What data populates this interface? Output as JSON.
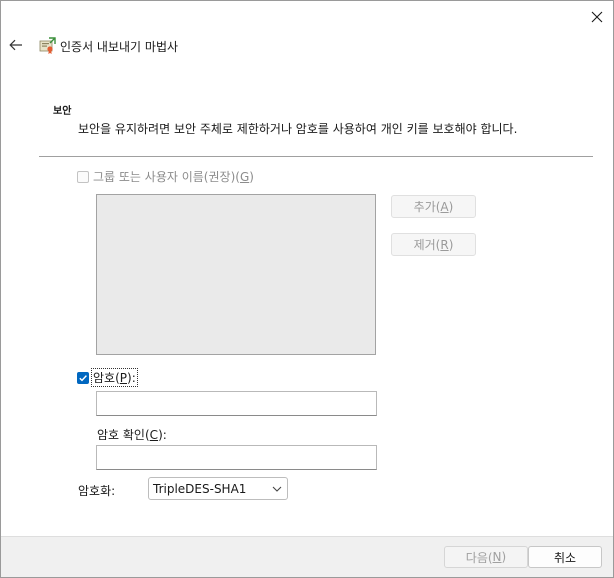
{
  "window": {
    "title": "인증서 내보내기 마법사"
  },
  "section": {
    "heading": "보안",
    "description": "보안을 유지하려면 보안 주체로 제한하거나 암호를 사용하여 개인 키를 보호해야 합니다."
  },
  "group_option": {
    "label_text": "그룹 또는 사용자 이름(권장)(",
    "access_key": "G",
    "label_suffix": ")",
    "checked": false,
    "enabled": false
  },
  "buttons": {
    "add_text": "추가(",
    "add_key": "A",
    "add_suffix": ")",
    "remove_text": "제거(",
    "remove_key": "R",
    "remove_suffix": ")"
  },
  "password_option": {
    "label_text": "암호(",
    "access_key": "P",
    "label_suffix": "):",
    "checked": true,
    "value": ""
  },
  "confirm_password": {
    "label_text": "암호 확인(",
    "access_key": "C",
    "label_suffix": "):",
    "value": ""
  },
  "encryption": {
    "label": "암호화:",
    "selected": "TripleDES-SHA1"
  },
  "footer": {
    "next_text": "다음(",
    "next_key": "N",
    "next_suffix": ")",
    "cancel_label": "취소"
  }
}
